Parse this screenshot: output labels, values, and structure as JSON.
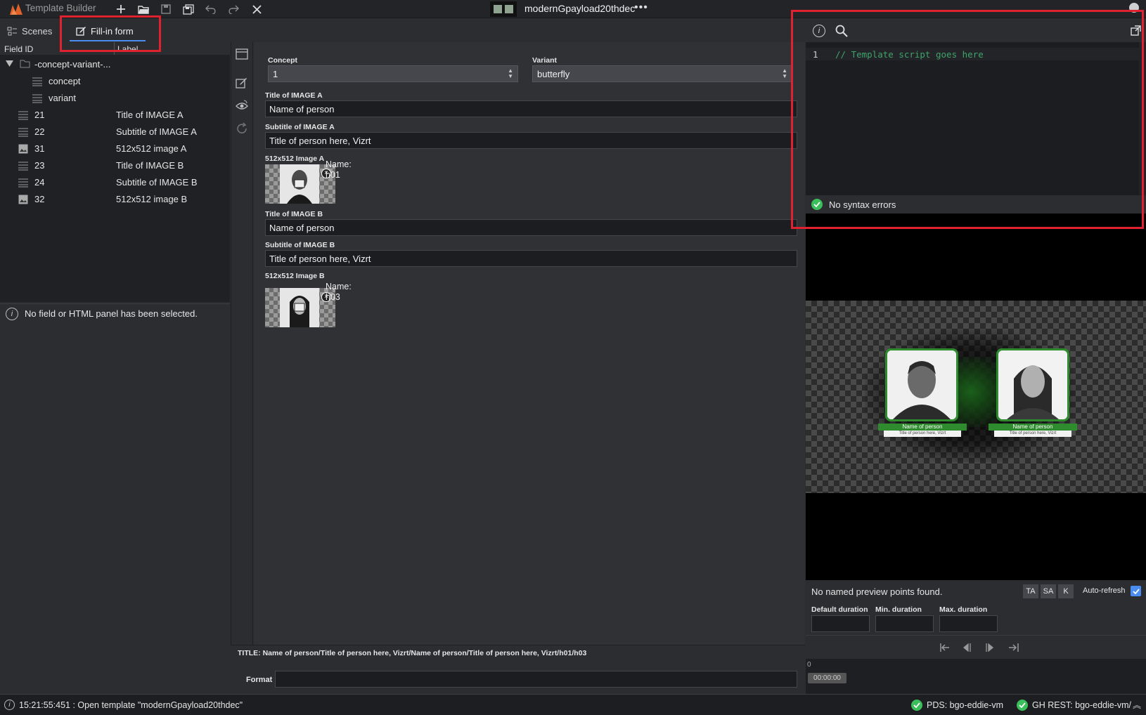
{
  "app": {
    "name": "Template Builder",
    "document_title": "modernGpayload20thdec"
  },
  "tabs": {
    "scenes": "Scenes",
    "fill_in_form": "Fill-in form"
  },
  "tree": {
    "headers": {
      "field_id": "Field ID",
      "label": "Label"
    },
    "root": "-concept-variant-...",
    "children": [
      {
        "id": "concept",
        "label": ""
      },
      {
        "id": "variant",
        "label": ""
      }
    ],
    "fields": [
      {
        "id": "21",
        "label": "Title of IMAGE A",
        "icon": "text-lines-icon"
      },
      {
        "id": "22",
        "label": "Subtitle of IMAGE A",
        "icon": "text-lines-icon"
      },
      {
        "id": "31",
        "label": "512x512 image A",
        "icon": "image-icon"
      },
      {
        "id": "23",
        "label": "Title of IMAGE B",
        "icon": "text-lines-icon"
      },
      {
        "id": "24",
        "label": "Subtitle of IMAGE B",
        "icon": "text-lines-icon"
      },
      {
        "id": "32",
        "label": "512x512 image B",
        "icon": "image-icon"
      }
    ]
  },
  "info": {
    "no_selection": "No field or HTML panel has been selected."
  },
  "form": {
    "concept_label": "Concept",
    "concept_value": "1",
    "variant_label": "Variant",
    "variant_value": "butterfly",
    "title_a_label": "Title of IMAGE A",
    "title_a_value": "Name of person",
    "subtitle_a_label": "Subtitle of IMAGE A",
    "subtitle_a_value": "Title of person here, Vizrt",
    "image_a_label": "512x512 Image A",
    "image_a_name_label": "Name:",
    "image_a_name": "h01",
    "title_b_label": "Title of IMAGE B",
    "title_b_value": "Name of person",
    "subtitle_b_label": "Subtitle of IMAGE B",
    "subtitle_b_value": "Title of person here, Vizrt",
    "image_b_label": "512x512 Image B",
    "image_b_name_label": "Name:",
    "image_b_name": "h03",
    "title_line": "TITLE: Name of person/Title of person here, Vizrt/Name of person/Title of person here, Vizrt/h01/h03",
    "format_label": "Format",
    "format_value": ""
  },
  "script": {
    "line_number": "1",
    "code": "// Template script goes here",
    "status": "No syntax errors"
  },
  "preview": {
    "card_a_name": "Name of person",
    "card_a_subtitle": "Title of person here, Vizrt",
    "card_b_name": "Name of person",
    "card_b_subtitle": "Title of person here, Vizrt",
    "no_points": "No named preview points found.",
    "btn_ta": "TA",
    "btn_sa": "SA",
    "btn_k": "K",
    "auto_refresh": "Auto-refresh",
    "auto_refresh_checked": true
  },
  "durations": {
    "default": "Default duration",
    "min": "Min. duration",
    "max": "Max. duration"
  },
  "timeline": {
    "zero": "0",
    "time": "00:00:00"
  },
  "status": {
    "log": "15:21:55:451 : Open template \"modernGpayload20thdec\"",
    "pds": "PDS: bgo-eddie-vm",
    "gh": "GH REST: bgo-eddie-vm/"
  },
  "colors": {
    "accent": "#4a8cf0",
    "success": "#3cbf5a",
    "highlight_box": "#e0212f",
    "card_green": "#2e8b2e"
  }
}
